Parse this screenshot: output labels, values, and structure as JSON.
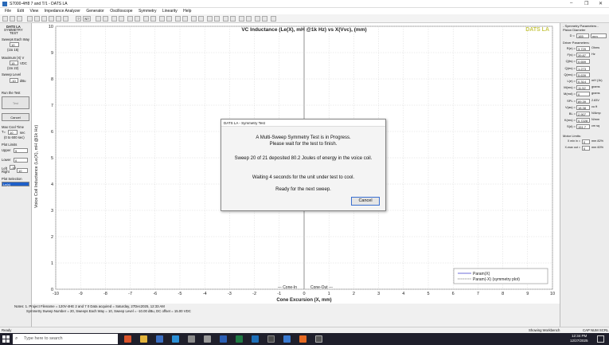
{
  "window": {
    "title": "S7000-4H8 7 and T/1 - DATS LA",
    "minimize": "–",
    "maximize": "❐",
    "close": "✕"
  },
  "menu": [
    "File",
    "Edit",
    "View",
    "Impedance Analyzer",
    "Generator",
    "Oscilloscope",
    "Symmetry",
    "Linearity",
    "Help"
  ],
  "toolbar": {
    "help_icon": "?",
    "nt_label": "N?"
  },
  "left_panel": {
    "app_name": "DATS LA",
    "mode_name": "SYMMETRY",
    "mode_sub": "TEST",
    "sweeps_each_way_label": "Sweeps Each Way",
    "sweeps_each_way_value": "10",
    "sweeps_each_way_range": "(1to 15)",
    "max_lx_label": "Maximum |X| V",
    "max_lx_value": "15",
    "max_lx_unit": "VDC",
    "max_lx_range": "(1to 22)",
    "sweep_level_label": "Sweep Level",
    "sweep_level_value": "-10",
    "sweep_level_unit": "dBu",
    "run_test_label": "Run the Test",
    "test_button": "Test",
    "cancel_button": "Cancel",
    "max_cool_label": "Max Cool Time",
    "max_cool_value": "10",
    "max_cool_unit": "sec",
    "max_cool_range": "(0 to 600 sec)",
    "plot_limits_label": "Plot Limits",
    "upper_label": "Upper",
    "upper_value": "5",
    "lower_label": "Lower",
    "lower_value": "0",
    "left_label": "Left",
    "left_value": "-10",
    "right_label": "Right",
    "right_value": "10",
    "plot_selection_label": "Plot Selection",
    "plot_selection_value": "Le(x)"
  },
  "chart_data": {
    "type": "line",
    "title": "VC Inductance (Le(X), mH @1k Hz) vs  X(Vvc), (mm)",
    "brand": "DATS LA",
    "xlabel": "Cone Excursion (X, mm)",
    "ylabel": "Voice Coil Inductance (Le(X), mH @1k Hz)",
    "xlim": [
      -10,
      10
    ],
    "ylim": [
      0,
      10
    ],
    "x_ticks": [
      "-10",
      "-9",
      "-8",
      "-7",
      "-6",
      "-5",
      "-4",
      "-3",
      "-2",
      "-1",
      "0",
      "1",
      "2",
      "3",
      "4",
      "5",
      "6",
      "7",
      "8",
      "9",
      "10"
    ],
    "y_ticks": [
      "0",
      "1",
      "2",
      "3",
      "4",
      "5",
      "6",
      "7",
      "8",
      "9",
      "10"
    ],
    "grid": true,
    "cone_in_label": "--- Cone-In",
    "cone_out_label": "Cone-Out ---",
    "legend_position": "bottom-right",
    "series": [
      {
        "name": "Param(X)",
        "values": []
      },
      {
        "name": "Param(-X) (symmetry plot)",
        "values": []
      }
    ]
  },
  "notes": {
    "prefix": "Notes:",
    "line1": "1. Project Filename = 120V-4HE 2 and 7 0     Data acquired = Saturday, 27Dec2025, 12:33 AM",
    "line2": "Symmetry Sweep Number = 20,   Sweeps Each Way = 10, Sweep Level = -10.00 dBu,  DC offset = 15.00 VDC"
  },
  "right_panel": {
    "section_title": "- Symmetry Parameters -",
    "piston_diameter_label": "Piston Diameter",
    "d_label": "D =",
    "d_value": "165",
    "d_unit": "mm",
    "driver_params_label": "Driver Parameters:",
    "params": [
      {
        "label": "R(e) =",
        "value": "3.729",
        "unit": "Ohms"
      },
      {
        "label": "F(s) =",
        "value": "39.87",
        "unit": "Hz"
      },
      {
        "label": "Q(ts) =",
        "value": "0.659",
        "unit": ""
      },
      {
        "label": "Q(es) =",
        "value": "1.273",
        "unit": ""
      },
      {
        "label": "Q(ms) =",
        "value": "5.639",
        "unit": ""
      },
      {
        "label": "L(e) =",
        "value": "0.314",
        "unit": "mH (1k)"
      },
      {
        "label": "M(ms) =",
        "value": "11.52",
        "unit": "grams"
      },
      {
        "label": "M(md) =",
        "value": "0",
        "unit": "grams"
      },
      {
        "label": "SPL =",
        "value": "89.39",
        "unit": "2.83V"
      },
      {
        "label": "V(as) =",
        "value": "18.38",
        "unit": "cu ft"
      },
      {
        "label": "BL =",
        "value": "2.907",
        "unit": "N/Amp"
      },
      {
        "label": "K(ms) =",
        "value": "0.7228",
        "unit": "N/mm"
      },
      {
        "label": "S(d) =",
        "value": "151.7",
        "unit": "cm sq"
      }
    ],
    "motor_limits_label": "Motor Limits:",
    "xmin_label": "X min in =",
    "xmin_value": "0",
    "xmin_unit": "mm 82%",
    "xmax_label": "X-max out =",
    "xmax_value": "0",
    "xmax_unit": "mm 60%"
  },
  "dialog": {
    "title": "DATS LA - Symmetry Test",
    "line1": "A Multi-Sweep Symmetry Test is in Progress.",
    "line2": "Please wait for the test to finish.",
    "line3": "Sweep 20 of 21 deposited 80.2 Joules of energy in the voice coil.",
    "line4": "Waiting 4 seconds for the unit under test to cool.",
    "line5": "Ready for the next sweep.",
    "cancel": "Cancel"
  },
  "status": {
    "left": "Ready",
    "middle": "Showing Workbench",
    "right": "CAP  NUM  SCRL"
  },
  "taskbar": {
    "search_placeholder": "Type here to search",
    "time": "12:34 PM",
    "date": "12/27/2025"
  },
  "colors": {
    "brand": "#c8c84a",
    "series1": "#3b3bcc",
    "series2": "#555555",
    "taskbar": "#1f1f2b",
    "dialog_button_border": "#3a6fd0"
  }
}
